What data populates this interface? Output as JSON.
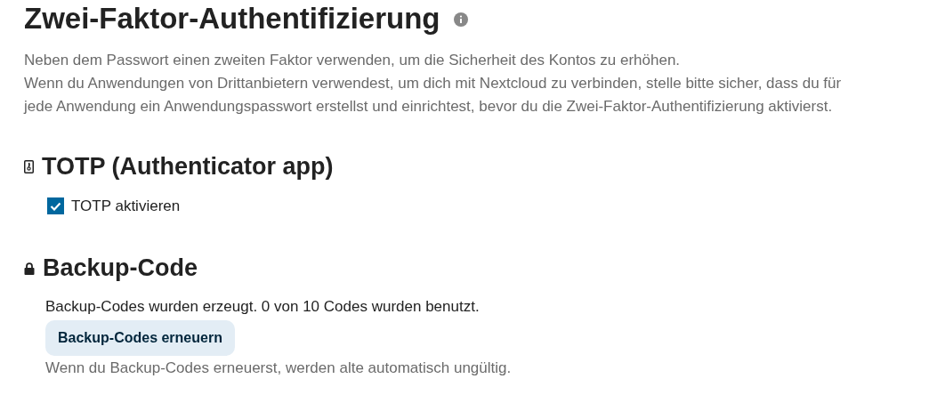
{
  "title": "Zwei-Faktor-Authentifizierung",
  "description": [
    "Neben dem Passwort einen zweiten Faktor verwenden, um die Sicherheit des Kontos zu erhöhen.",
    "Wenn du Anwendungen von Drittanbietern verwendest, um dich mit Nextcloud zu verbinden, stelle bitte sicher, dass du für jede Anwendung ein Anwendungspasswort erstellst und einrichtest, bevor du die Zwei-Faktor-Authentifizierung aktivierst."
  ],
  "totp": {
    "heading": "TOTP (Authenticator app)",
    "checkbox": {
      "label": "TOTP aktivieren",
      "checked": true
    }
  },
  "backup": {
    "heading": "Backup-Code",
    "status": "Backup-Codes wurden erzeugt. 0 von 10 Codes wurden benutzt.",
    "button": "Backup-Codes erneuern",
    "hint": "Wenn du Backup-Codes erneuerst, werden alte automatisch ungültig."
  }
}
